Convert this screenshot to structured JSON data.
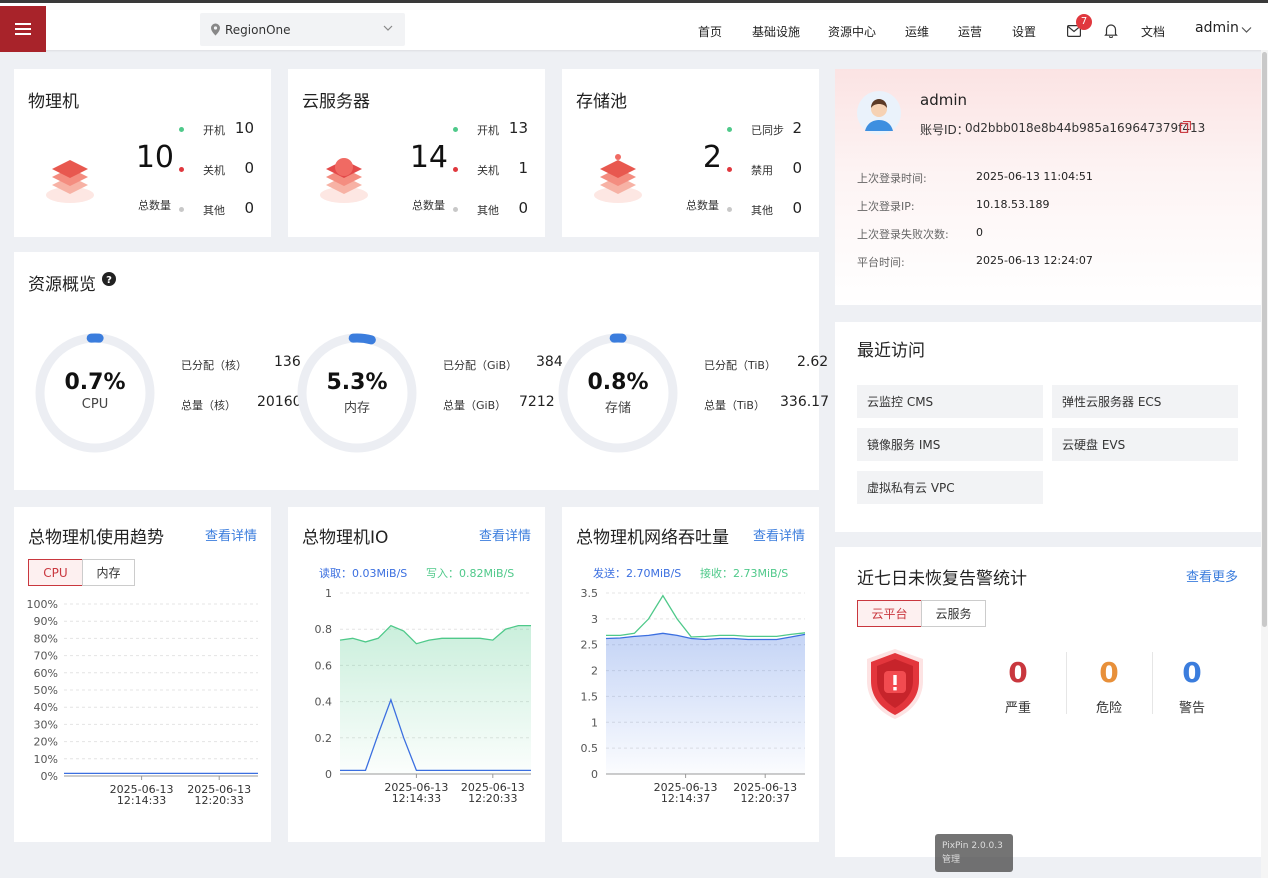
{
  "header": {
    "region": "RegionOne",
    "nav": [
      "首页",
      "基础设施",
      "资源中心",
      "运维",
      "运营",
      "设置"
    ],
    "mail_badge": "7",
    "docs": "文档",
    "user": "admin"
  },
  "summary_cards": [
    {
      "title": "物理机",
      "total": "10",
      "total_label": "总数量",
      "stats": [
        {
          "label": "开机",
          "value": "10"
        },
        {
          "label": "关机",
          "value": "0"
        },
        {
          "label": "其他",
          "value": "0"
        }
      ]
    },
    {
      "title": "云服务器",
      "total": "14",
      "total_label": "总数量",
      "stats": [
        {
          "label": "开机",
          "value": "13"
        },
        {
          "label": "关机",
          "value": "1"
        },
        {
          "label": "其他",
          "value": "0"
        }
      ]
    },
    {
      "title": "存储池",
      "total": "2",
      "total_label": "总数量",
      "stats": [
        {
          "label": "已同步",
          "value": "2"
        },
        {
          "label": "禁用",
          "value": "0"
        },
        {
          "label": "其他",
          "value": "0"
        }
      ]
    }
  ],
  "resource_overview": {
    "title": "资源概览",
    "items": [
      {
        "percent": "0.7%",
        "fraction": 0.007,
        "name": "CPU",
        "allocated_label": "已分配（核）",
        "allocated": "136",
        "total_label": "总量（核）",
        "total": "20160"
      },
      {
        "percent": "5.3%",
        "fraction": 0.053,
        "name": "内存",
        "allocated_label": "已分配（GiB）",
        "allocated": "384",
        "total_label": "总量（GiB）",
        "total": "7212"
      },
      {
        "percent": "0.8%",
        "fraction": 0.008,
        "name": "存储",
        "allocated_label": "已分配（TiB）",
        "allocated": "2.62",
        "total_label": "总量（TiB）",
        "total": "336.17"
      }
    ]
  },
  "profile": {
    "name": "admin",
    "account_label": "账号ID：",
    "account_id": "0d2bbb018e8b44b985a169647379f413",
    "rows": [
      {
        "label": "上次登录时间:",
        "value": "2025-06-13 11:04:51"
      },
      {
        "label": "上次登录IP:",
        "value": "10.18.53.189"
      },
      {
        "label": "上次登录失败次数:",
        "value": "0"
      },
      {
        "label": "平台时间:",
        "value": "2025-06-13 12:24:07"
      }
    ]
  },
  "recent": {
    "title": "最近访问",
    "items": [
      "云监控 CMS",
      "弹性云服务器 ECS",
      "镜像服务 IMS",
      "云硬盘 EVS",
      "虚拟私有云 VPC"
    ]
  },
  "alerts": {
    "title": "近七日未恢复告警统计",
    "more": "查看更多",
    "tabs": [
      "云平台",
      "云服务"
    ],
    "counts": [
      {
        "label": "严重",
        "value": "0",
        "color": "#c9373e"
      },
      {
        "label": "危险",
        "value": "0",
        "color": "#e8903a"
      },
      {
        "label": "警告",
        "value": "0",
        "color": "#3b7ddd"
      }
    ]
  },
  "watermark": {
    "line1": "PixPin 2.0.0.3",
    "line2": "管理"
  },
  "chart_data": [
    {
      "type": "line",
      "title": "总物理机使用趋势",
      "link": "查看详情",
      "tabs": [
        "CPU",
        "内存"
      ],
      "y_ticks": [
        "100%",
        "90%",
        "80%",
        "70%",
        "60%",
        "50%",
        "40%",
        "30%",
        "20%",
        "10%",
        "0%"
      ],
      "x_labels": [
        [
          "2025-06-13",
          "12:14:33"
        ],
        [
          "2025-06-13",
          "12:20:33"
        ]
      ],
      "ylim": [
        0,
        100
      ],
      "series": [
        {
          "values": [
            1.5,
            1.5,
            1.5,
            1.5,
            1.5,
            1.5,
            1.5,
            1.5,
            1.5,
            1.5,
            1.5,
            1.5,
            1.5
          ],
          "color": "#3b6fe0"
        }
      ]
    },
    {
      "type": "area",
      "title": "总物理机IO",
      "link": "查看详情",
      "legend": [
        {
          "name": "读取：0.03MiB/S",
          "color": "#3b6fe0"
        },
        {
          "name": "写入：0.82MiB/S",
          "color": "#4fc98a"
        }
      ],
      "y_ticks": [
        "1",
        "0.8",
        "0.6",
        "0.4",
        "0.2",
        "0"
      ],
      "x_labels": [
        [
          "2025-06-13",
          "12:14:33"
        ],
        [
          "2025-06-13",
          "12:20:33"
        ]
      ],
      "ylim": [
        0,
        1
      ],
      "series": [
        {
          "values": [
            0.74,
            0.75,
            0.73,
            0.75,
            0.82,
            0.79,
            0.72,
            0.74,
            0.75,
            0.75,
            0.75,
            0.75,
            0.74,
            0.8,
            0.82,
            0.82
          ],
          "color": "#4fc98a",
          "fill": true
        },
        {
          "values": [
            0.02,
            0.02,
            0.02,
            0.22,
            0.41,
            0.2,
            0.02,
            0.02,
            0.02,
            0.02,
            0.02,
            0.02,
            0.02,
            0.02,
            0.02,
            0.02
          ],
          "color": "#3b6fe0",
          "fill": false
        }
      ]
    },
    {
      "type": "area",
      "title": "总物理机网络吞吐量",
      "link": "查看详情",
      "legend": [
        {
          "name": "发送：2.70MiB/S",
          "color": "#3b6fe0"
        },
        {
          "name": "接收：2.73MiB/S",
          "color": "#4fc98a"
        }
      ],
      "y_ticks": [
        "3.5",
        "3",
        "2.5",
        "2",
        "1.5",
        "1",
        "0.5",
        "0"
      ],
      "x_labels": [
        [
          "2025-06-13",
          "12:14:37"
        ],
        [
          "2025-06-13",
          "12:20:37"
        ]
      ],
      "ylim": [
        0,
        3.5
      ],
      "series": [
        {
          "values": [
            2.68,
            2.68,
            2.72,
            3.0,
            3.45,
            3.0,
            2.65,
            2.66,
            2.68,
            2.68,
            2.66,
            2.66,
            2.66,
            2.7,
            2.73
          ],
          "color": "#4fc98a",
          "fill": false
        },
        {
          "values": [
            2.62,
            2.63,
            2.66,
            2.68,
            2.72,
            2.68,
            2.62,
            2.6,
            2.62,
            2.62,
            2.6,
            2.6,
            2.6,
            2.65,
            2.7
          ],
          "color": "#3b6fe0",
          "fill": true
        }
      ]
    }
  ]
}
